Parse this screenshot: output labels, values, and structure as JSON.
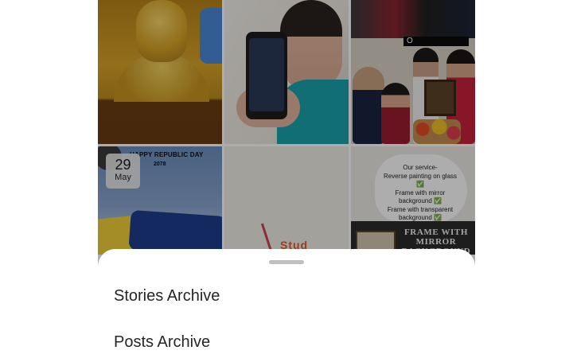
{
  "grid": {
    "tiles": [
      {
        "subject": "golden buddha statue"
      },
      {
        "subject": "woman holding phone"
      },
      {
        "subject": "group photo with framed picture",
        "caption": "O"
      },
      {
        "subject": "republic day post",
        "title": "HAPPY REPUBLIC DAY",
        "year": "2078"
      },
      {
        "subject": "craft sticks",
        "text": "Stud"
      },
      {
        "subject": "frame service ad",
        "lines": [
          "Our service-",
          "Reverse painting on glass",
          "✅",
          "Frame with mirror",
          "background ✅",
          "Frame with transparent",
          "background ✅"
        ],
        "banner": [
          "FRAME WITH",
          "MIRROR",
          "BACKGROUND"
        ]
      }
    ]
  },
  "date_badge": {
    "day": "29",
    "month": "May"
  },
  "bottom_sheet": {
    "options": [
      {
        "label": "Stories Archive"
      },
      {
        "label": "Posts Archive"
      }
    ]
  },
  "colors": {
    "dim_overlay": "#000000",
    "sheet_bg": "#ffffff",
    "handle": "#bfbfbf",
    "text": "#262626"
  }
}
